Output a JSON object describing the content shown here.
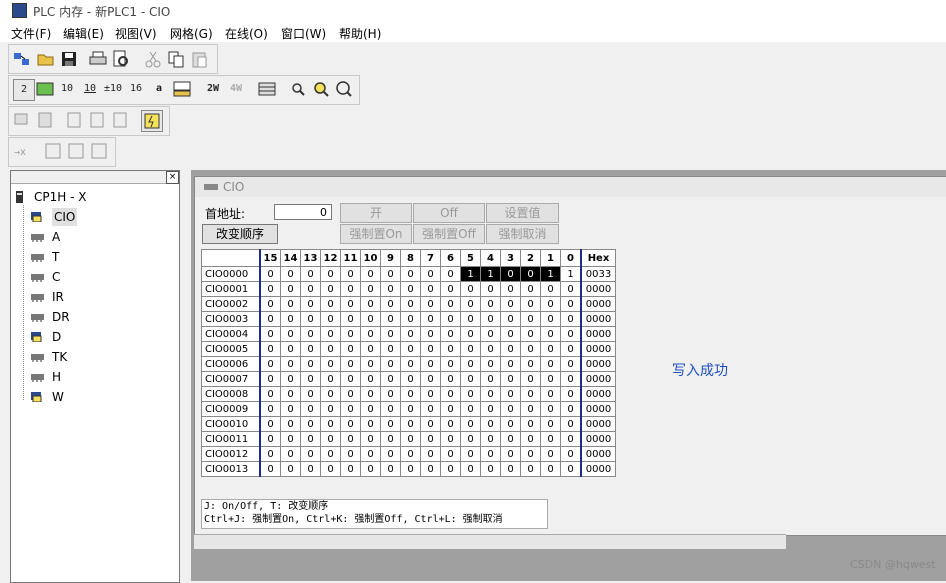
{
  "window": {
    "title": "PLC 内存 - 新PLC1 - CIO"
  },
  "menu": [
    "文件(F)",
    "编辑(E)",
    "视图(V)",
    "网格(G)",
    "在线(O)",
    "窗口(W)",
    "帮助(H)"
  ],
  "toolbar2": [
    "2",
    "10",
    "10",
    "±10",
    "16",
    "a",
    "2W",
    "4W"
  ],
  "tree": {
    "root": "CP1H - X",
    "items": [
      "CIO",
      "A",
      "T",
      "C",
      "IR",
      "DR",
      "D",
      "TK",
      "H",
      "W"
    ]
  },
  "child": {
    "title": "CIO"
  },
  "form": {
    "addr_label": "首地址:",
    "addr_value": "0",
    "btn_reorder": "改变顺序",
    "btn_on": "开",
    "btn_off": "Off",
    "btn_setval": "设置值",
    "btn_force_on": "强制置On",
    "btn_force_off": "强制置Off",
    "btn_force_cancel": "强制取消"
  },
  "grid": {
    "headers": [
      "15",
      "14",
      "13",
      "12",
      "11",
      "10",
      "9",
      "8",
      "7",
      "6",
      "5",
      "4",
      "3",
      "2",
      "1",
      "0",
      "Hex"
    ],
    "rows": [
      {
        "addr": "CIO0000",
        "bits": [
          "0",
          "0",
          "0",
          "0",
          "0",
          "0",
          "0",
          "0",
          "0",
          "0",
          "1",
          "1",
          "0",
          "0",
          "1",
          "1"
        ],
        "hex": "0033"
      },
      {
        "addr": "CIO0001",
        "bits": [
          "0",
          "0",
          "0",
          "0",
          "0",
          "0",
          "0",
          "0",
          "0",
          "0",
          "0",
          "0",
          "0",
          "0",
          "0",
          "0"
        ],
        "hex": "0000"
      },
      {
        "addr": "CIO0002",
        "bits": [
          "0",
          "0",
          "0",
          "0",
          "0",
          "0",
          "0",
          "0",
          "0",
          "0",
          "0",
          "0",
          "0",
          "0",
          "0",
          "0"
        ],
        "hex": "0000"
      },
      {
        "addr": "CIO0003",
        "bits": [
          "0",
          "0",
          "0",
          "0",
          "0",
          "0",
          "0",
          "0",
          "0",
          "0",
          "0",
          "0",
          "0",
          "0",
          "0",
          "0"
        ],
        "hex": "0000"
      },
      {
        "addr": "CIO0004",
        "bits": [
          "0",
          "0",
          "0",
          "0",
          "0",
          "0",
          "0",
          "0",
          "0",
          "0",
          "0",
          "0",
          "0",
          "0",
          "0",
          "0"
        ],
        "hex": "0000"
      },
      {
        "addr": "CIO0005",
        "bits": [
          "0",
          "0",
          "0",
          "0",
          "0",
          "0",
          "0",
          "0",
          "0",
          "0",
          "0",
          "0",
          "0",
          "0",
          "0",
          "0"
        ],
        "hex": "0000"
      },
      {
        "addr": "CIO0006",
        "bits": [
          "0",
          "0",
          "0",
          "0",
          "0",
          "0",
          "0",
          "0",
          "0",
          "0",
          "0",
          "0",
          "0",
          "0",
          "0",
          "0"
        ],
        "hex": "0000"
      },
      {
        "addr": "CIO0007",
        "bits": [
          "0",
          "0",
          "0",
          "0",
          "0",
          "0",
          "0",
          "0",
          "0",
          "0",
          "0",
          "0",
          "0",
          "0",
          "0",
          "0"
        ],
        "hex": "0000"
      },
      {
        "addr": "CIO0008",
        "bits": [
          "0",
          "0",
          "0",
          "0",
          "0",
          "0",
          "0",
          "0",
          "0",
          "0",
          "0",
          "0",
          "0",
          "0",
          "0",
          "0"
        ],
        "hex": "0000"
      },
      {
        "addr": "CIO0009",
        "bits": [
          "0",
          "0",
          "0",
          "0",
          "0",
          "0",
          "0",
          "0",
          "0",
          "0",
          "0",
          "0",
          "0",
          "0",
          "0",
          "0"
        ],
        "hex": "0000"
      },
      {
        "addr": "CIO0010",
        "bits": [
          "0",
          "0",
          "0",
          "0",
          "0",
          "0",
          "0",
          "0",
          "0",
          "0",
          "0",
          "0",
          "0",
          "0",
          "0",
          "0"
        ],
        "hex": "0000"
      },
      {
        "addr": "CIO0011",
        "bits": [
          "0",
          "0",
          "0",
          "0",
          "0",
          "0",
          "0",
          "0",
          "0",
          "0",
          "0",
          "0",
          "0",
          "0",
          "0",
          "0"
        ],
        "hex": "0000"
      },
      {
        "addr": "CIO0012",
        "bits": [
          "0",
          "0",
          "0",
          "0",
          "0",
          "0",
          "0",
          "0",
          "0",
          "0",
          "0",
          "0",
          "0",
          "0",
          "0",
          "0"
        ],
        "hex": "0000"
      },
      {
        "addr": "CIO0013",
        "bits": [
          "0",
          "0",
          "0",
          "0",
          "0",
          "0",
          "0",
          "0",
          "0",
          "0",
          "0",
          "0",
          "0",
          "0",
          "0",
          "0"
        ],
        "hex": "0000"
      }
    ]
  },
  "hint": {
    "line1": "J: On/Off,   T: 改变顺序",
    "line2": " Ctrl+J: 强制置On,  Ctrl+K:  强制置Off,  Ctrl+L: 强制取消"
  },
  "status_message": "写入成功",
  "watermark": "CSDN @hqwest"
}
